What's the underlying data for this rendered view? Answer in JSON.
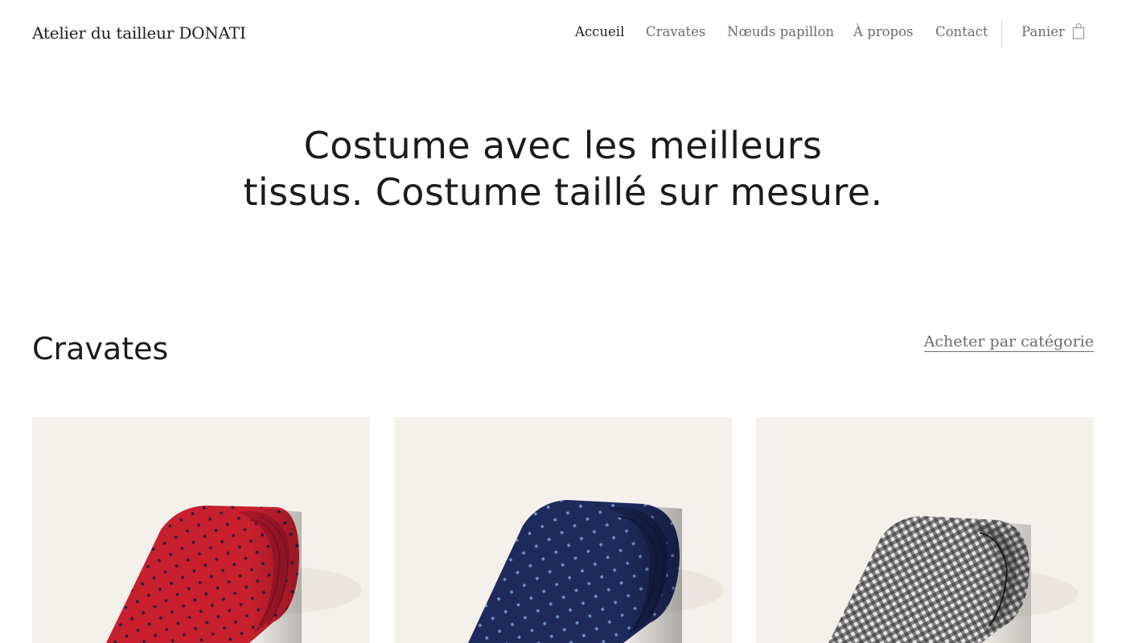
{
  "header": {
    "logo": "Atelier du tailleur DONATI",
    "nav": [
      {
        "label": "Accueil",
        "active": true
      },
      {
        "label": "Cravates",
        "active": false
      },
      {
        "label": "Nœuds papillon",
        "active": false
      },
      {
        "label": "À propos",
        "active": false
      },
      {
        "label": "Contact",
        "active": false
      }
    ],
    "cart_label": "Panier"
  },
  "hero": {
    "line1": "Costume avec les meilleurs",
    "line2": "tissus. Costume taillé sur mesure."
  },
  "section": {
    "title": "Cravates",
    "link": "Acheter par catégorie"
  },
  "products": [
    {
      "image": "red-dotted-tie",
      "color": "#c8202f",
      "dot_color": "#2a1f3c"
    },
    {
      "image": "navy-dotted-tie",
      "color": "#1e2a5c",
      "dot_color": "#6f8cc4"
    },
    {
      "image": "gingham-tie",
      "color": "#cfcfcf",
      "dot_color": "#2a2a2a"
    }
  ],
  "colors": {
    "background": "#ffffff",
    "card_background": "#f4f1ec",
    "text_primary": "#1f1f1f",
    "text_muted": "#6b6b6b"
  }
}
